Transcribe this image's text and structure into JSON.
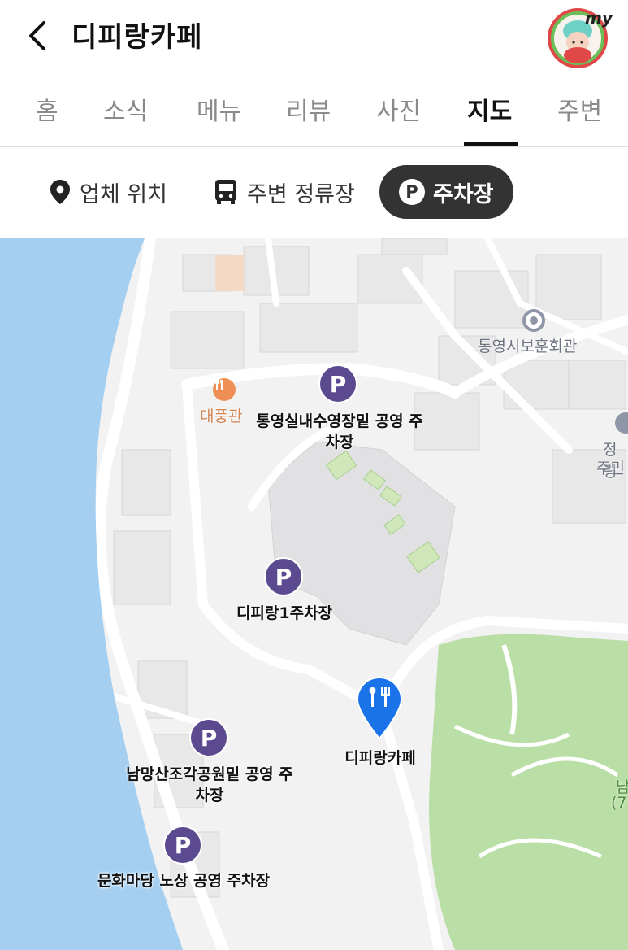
{
  "header": {
    "title": "디피랑카페",
    "avatar_text": "my"
  },
  "tabs": [
    "홈",
    "소식",
    "메뉴",
    "리뷰",
    "사진",
    "지도",
    "주변"
  ],
  "active_tab": "지도",
  "filters": {
    "location": "업체 위치",
    "bus": "주변 정류장",
    "parking": "주차장",
    "parking_badge": "P"
  },
  "map": {
    "parking_pin_letter": "P",
    "parking": {
      "p1": "통영실내수영장밑 공영 주\n차장",
      "p2": "디피랑1주차장",
      "p3": "남망산조각공원밑 공영 주\n차장",
      "p4": "문화마당 노상 공영 주차장"
    },
    "cafe_label": "디피랑카페",
    "poi": {
      "restaurant": "대풍관",
      "hall": "통영시보훈회관",
      "office_1": "정링",
      "office_2": "주민",
      "park_1": "남",
      "park_2": "(7"
    },
    "colors": {
      "water": "#a4cff1",
      "park": "#b9dfa6",
      "parking_pin": "#5b4a8f",
      "cafe_pin": "#1a73e8"
    }
  }
}
